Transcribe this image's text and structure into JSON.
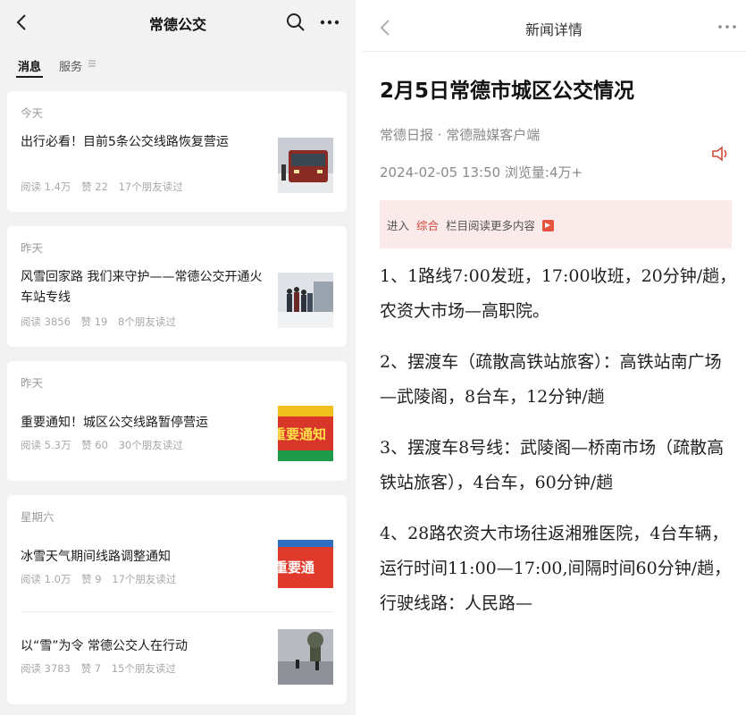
{
  "left": {
    "nav": {
      "title": "常德公交"
    },
    "tabs": [
      {
        "label": "消息"
      },
      {
        "label": "服务"
      }
    ],
    "groups": [
      {
        "day": "今天",
        "articles": [
          {
            "title": "出行必看！目前5条公交线路恢复营运",
            "reads": "阅读 1.4万",
            "likes": "赞 22",
            "friends": "17个朋友读过",
            "thumb": "bus-photo"
          }
        ]
      },
      {
        "day": "昨天",
        "articles": [
          {
            "title": "风雪回家路 我们来守护——常德公交开通火车站专线",
            "reads": "阅读 3856",
            "likes": "赞 19",
            "friends": "8个朋友读过",
            "thumb": "people-bus-photo"
          }
        ]
      },
      {
        "day": "昨天",
        "articles": [
          {
            "title": "重要通知！城区公交线路暂停营运",
            "reads": "阅读 5.3万",
            "likes": "赞 60",
            "friends": "30个朋友读过",
            "thumb": "important-notice-banner"
          }
        ]
      },
      {
        "day": "星期六",
        "articles": [
          {
            "title": "冰雪天气期间线路调整通知",
            "reads": "阅读 1.0万",
            "likes": "赞 9",
            "friends": "17个朋友读过",
            "thumb": "notice-banner-2"
          },
          {
            "title": "以“雪”为令  常德公交人在行动",
            "reads": "阅读 3783",
            "likes": "赞 7",
            "friends": "15个朋友读过",
            "thumb": "snow-street-photo"
          }
        ]
      }
    ],
    "thumb_text": {
      "notice": "重要通知",
      "notice2": "重要通"
    }
  },
  "right": {
    "nav": {
      "title": "新闻详情"
    },
    "headline": "2月5日常德市城区公交情况",
    "source": "常德日报 · 常德融媒客户端",
    "datetime": "2024-02-05  13:50  浏览量:4万+",
    "banner": {
      "prefix": "进入",
      "link": "综合",
      "suffix": "栏目阅读更多内容"
    },
    "paragraphs": [
      "1、1路线7:00发班，17:00收班，20分钟/趟，农资大市场—高职院。",
      "2、摆渡车（疏散高铁站旅客）：高铁站南广场—武陵阁，8台车，12分钟/趟",
      "3、摆渡车8号线：武陵阁—桥南市场（疏散高铁站旅客），4台车，60分钟/趟",
      "4、28路农资大市场往返湘雅医院，4台车辆，运行时间11:00—17:00,间隔时间60分钟/趟，行驶线路：人民路—"
    ]
  },
  "colors": {
    "accent_red": "#d24b3c",
    "banner_bg": "#faeaea",
    "left_bg": "#f2f2f2"
  }
}
